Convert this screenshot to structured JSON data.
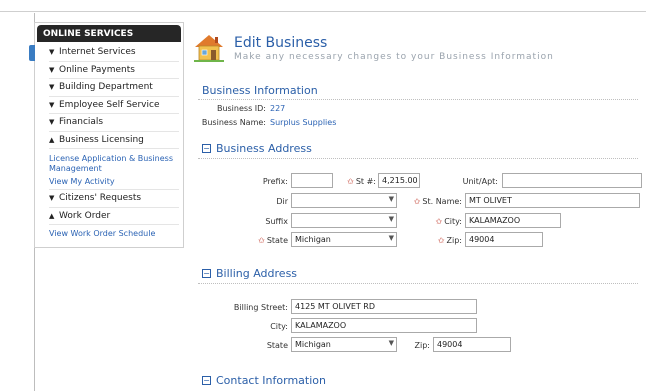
{
  "sidebar": {
    "header": "ONLINE SERVICES",
    "items": [
      {
        "label": "Internet Services",
        "state": "collapsed"
      },
      {
        "label": "Online Payments",
        "state": "collapsed"
      },
      {
        "label": "Building Department",
        "state": "collapsed"
      },
      {
        "label": "Employee Self Service",
        "state": "collapsed"
      },
      {
        "label": "Financials",
        "state": "collapsed"
      },
      {
        "label": "Business Licensing",
        "state": "expanded"
      }
    ],
    "licensing_links": [
      "License Application & Business Management",
      "View My Activity"
    ],
    "items2": [
      {
        "label": "Citizens' Requests",
        "state": "collapsed"
      },
      {
        "label": "Work Order",
        "state": "expanded"
      }
    ],
    "workorder_links": [
      "View Work Order Schedule"
    ]
  },
  "header": {
    "title": "Edit Business",
    "subtitle": "Make any necessary changes to your Business Information",
    "icon": "house-icon"
  },
  "business_info": {
    "title": "Business Information",
    "id_label": "Business ID:",
    "id_value": "227",
    "name_label": "Business Name:",
    "name_value": "Surplus Supplies"
  },
  "business_address": {
    "title": "Business Address",
    "prefix_label": "Prefix:",
    "prefix_value": "",
    "st_num_label": "St #:",
    "st_num_value": "4,215.00",
    "unit_label": "Unit/Apt:",
    "unit_value": "",
    "dir_label": "Dir",
    "dir_value": "",
    "st_name_label": "St. Name:",
    "st_name_value": "MT OLIVET",
    "suffix_label": "Suffix",
    "suffix_value": "",
    "city_label": "City:",
    "city_value": "KALAMAZOO",
    "state_label": "State",
    "state_value": "Michigan",
    "zip_label": "Zip:",
    "zip_value": "49004"
  },
  "billing_address": {
    "title": "Billing Address",
    "street_label": "Billing Street:",
    "street_value": "4125 MT OLIVET RD",
    "city_label": "City:",
    "city_value": "KALAMAZOO",
    "state_label": "State",
    "state_value": "Michigan",
    "zip_label": "Zip:",
    "zip_value": "49004"
  },
  "contact": {
    "title": "Contact Information"
  },
  "colors": {
    "link": "#2b63b4",
    "heading": "#2b5fa8",
    "required_star": "#c0392b",
    "sidebar_header_bg": "#262626"
  }
}
